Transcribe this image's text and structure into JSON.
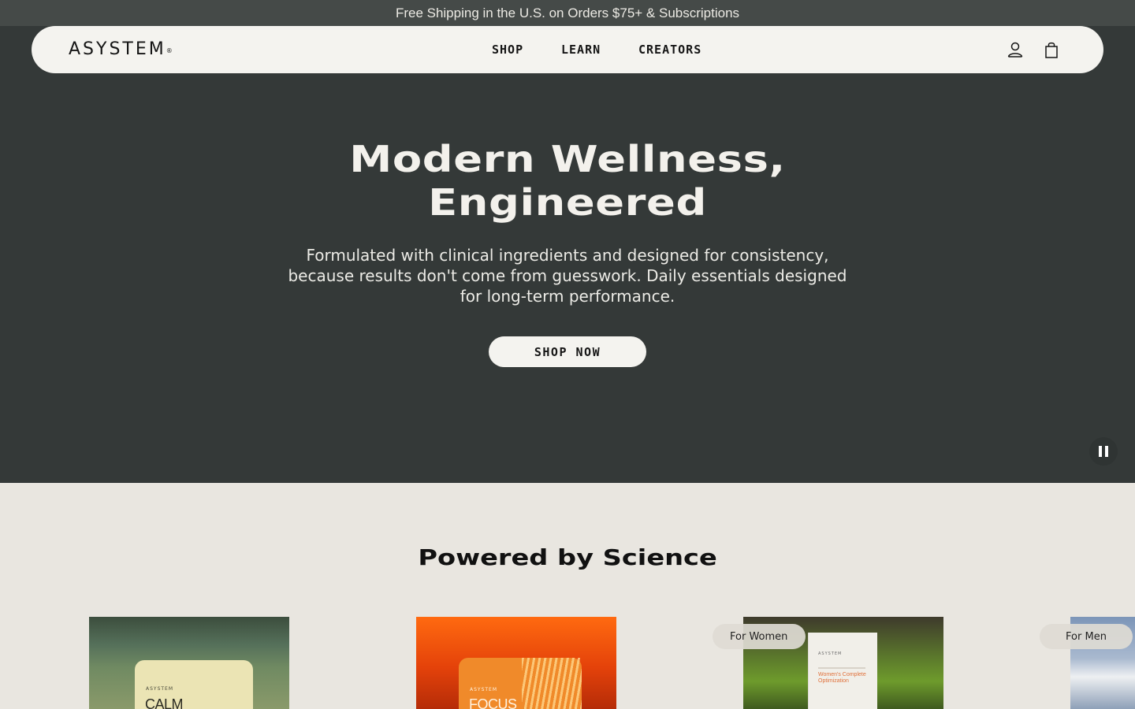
{
  "announcement": "Free Shipping in the U.S. on Orders $75+ & Subscriptions",
  "header": {
    "logo": "ASYSTEM",
    "logo_mark": "®",
    "menu": [
      {
        "label": "SHOP"
      },
      {
        "label": "LEARN"
      },
      {
        "label": "CREATORS"
      }
    ],
    "icons": [
      "account-icon",
      "cart-icon"
    ]
  },
  "hero": {
    "title_line1": "Modern Wellness,",
    "title_line2": "Engineered",
    "subtitle_line1": "Formulated with clinical ingredients and designed for consistency,",
    "subtitle_line2": "because results don't come from guesswork. Daily essentials designed",
    "subtitle_line3": "for long-term performance.",
    "cta": "SHOP NOW"
  },
  "science": {
    "title": "Powered by Science",
    "products": [
      {
        "brand": "ASYSTEM",
        "name": "CALM"
      },
      {
        "brand": "ASYSTEM",
        "name": "FOCUS"
      },
      {
        "tag": "For Women",
        "brand": "ASYSTEM",
        "name": "Women's Complete Optimization"
      },
      {
        "tag": "For Men"
      }
    ]
  },
  "colors": {
    "announcement_bg": "#454a48",
    "hero_bg": "#343938",
    "nav_bg": "#f4f3ef",
    "section_bg": "#e9e6e0"
  }
}
